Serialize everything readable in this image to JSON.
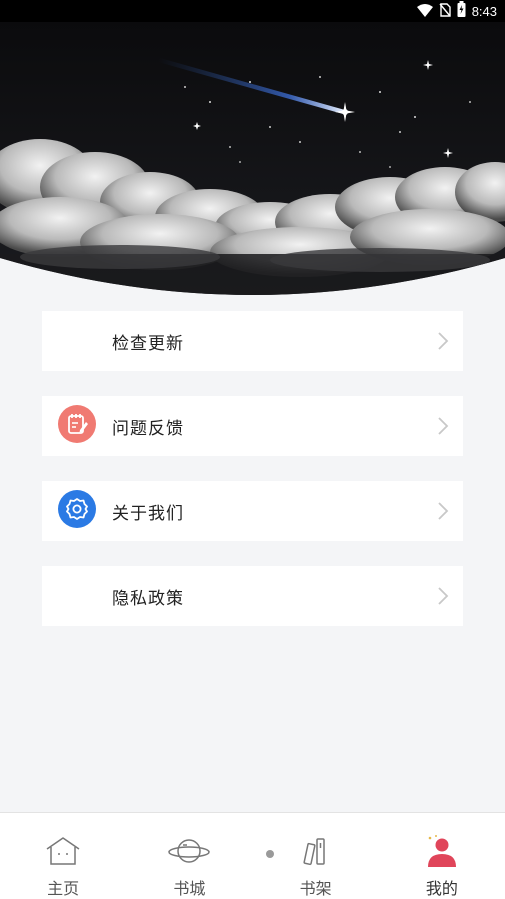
{
  "status_bar": {
    "time": "8:43",
    "icons": [
      "wifi-icon",
      "no-sim-icon",
      "battery-charging-icon"
    ]
  },
  "header": {
    "image": "night-sky-shooting-star-clouds"
  },
  "menu": [
    {
      "label": "检查更新",
      "icon": "none"
    },
    {
      "label": "问题反馈",
      "icon": "feedback-notepad-icon",
      "icon_color": "#f07a72"
    },
    {
      "label": "关于我们",
      "icon": "settings-gear-icon",
      "icon_color": "#2b7ae4"
    },
    {
      "label": "隐私政策",
      "icon": "none"
    }
  ],
  "tabbar": {
    "tabs": [
      {
        "label": "主页",
        "icon": "home-icon"
      },
      {
        "label": "书城",
        "icon": "planet-icon"
      },
      {
        "label": "书架",
        "icon": "bookshelf-icon"
      },
      {
        "label": "我的",
        "icon": "user-icon",
        "active": true,
        "active_color": "#e0455a"
      }
    ]
  }
}
